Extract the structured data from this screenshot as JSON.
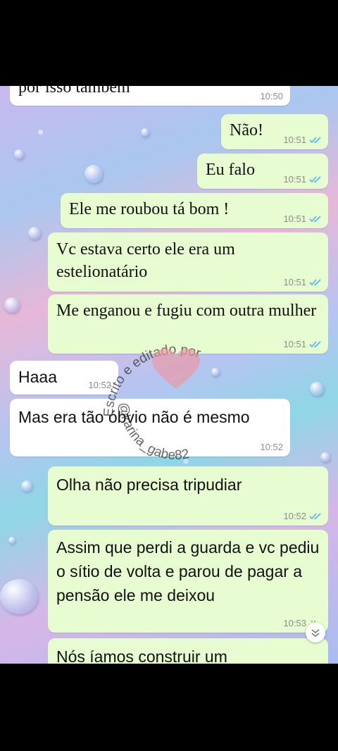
{
  "messages": [
    {
      "text": "por isso também",
      "time": "10:50",
      "dir": "in",
      "ticks": false
    },
    {
      "text": "Não!",
      "time": "10:51",
      "dir": "out",
      "ticks": true
    },
    {
      "text": "Eu falo",
      "time": "10:51",
      "dir": "out",
      "ticks": true
    },
    {
      "text": "Ele me roubou tá bom !",
      "time": "10:51",
      "dir": "out",
      "ticks": true
    },
    {
      "text": "Vc estava certo ele era um estelionatário",
      "time": "10:51",
      "dir": "out",
      "ticks": true
    },
    {
      "text": "Me enganou e fugiu com outra mulher",
      "time": "10:51",
      "dir": "out",
      "ticks": true
    },
    {
      "text": "Haaa",
      "time": "10:52",
      "dir": "in",
      "ticks": false
    },
    {
      "text": "Mas era tão óbvio não é mesmo",
      "time": "10:52",
      "dir": "in",
      "ticks": false
    },
    {
      "text": "Olha não precisa tripudiar",
      "time": "10:52",
      "dir": "out",
      "ticks": true
    },
    {
      "text": "Assim que perdi a guarda e vc pediu o sítio de volta e parou de pagar a pensão ele me deixou",
      "time": "10:53",
      "dir": "out",
      "ticks": true
    },
    {
      "text": "Nós íamos construir um",
      "time": "",
      "dir": "out",
      "ticks": false
    }
  ],
  "watermark": {
    "line1": "Escrito e editado por",
    "line2": "@karina_gabe82"
  },
  "colors": {
    "outgoing_bubble": "#e7fcd0",
    "incoming_bubble": "#ffffff",
    "read_ticks": "#4fb6ec"
  },
  "icons": {
    "read_receipt": "double-check-icon",
    "scroll_down": "chevron-double-down-icon"
  }
}
